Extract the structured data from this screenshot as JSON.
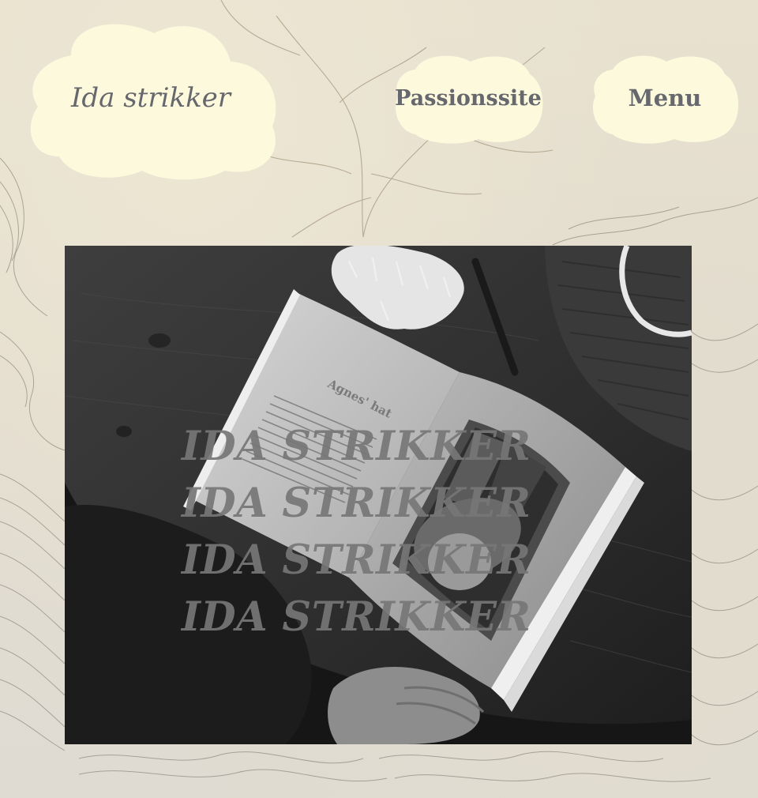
{
  "header": {
    "logo_label": "Ida strikker",
    "passion_label": "Passionssite",
    "menu_label": "Menu"
  },
  "hero": {
    "title_lines": [
      "IDA STRIKKER",
      "IDA STRIKKER",
      "IDA STRIKKER",
      "IDA STRIKKER"
    ],
    "book_heading": "Agnes' hat"
  },
  "colors": {
    "cloud_fill": "#fdf9dc",
    "cloud_text": "#67686e",
    "paper_background": "#e6e0d2",
    "overlay_text": "#767676"
  }
}
